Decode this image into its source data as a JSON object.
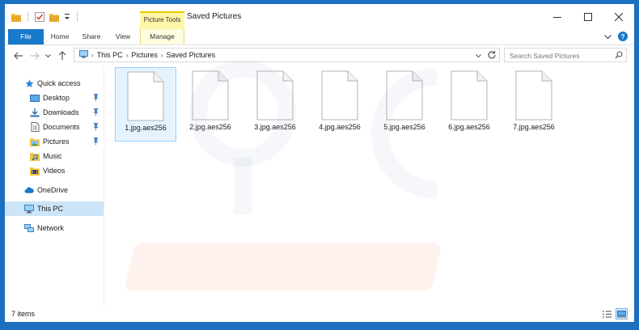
{
  "window": {
    "title": "Saved Pictures",
    "context_tab_label": "Picture Tools"
  },
  "ribbon": {
    "tabs": [
      {
        "label": "File"
      },
      {
        "label": "Home"
      },
      {
        "label": "Share"
      },
      {
        "label": "View"
      },
      {
        "label": "Manage"
      }
    ]
  },
  "address": {
    "crumbs": [
      "This PC",
      "Pictures",
      "Saved Pictures"
    ]
  },
  "search": {
    "placeholder": "Search Saved Pictures"
  },
  "nav": {
    "items": [
      {
        "label": "Quick access",
        "icon": "star-icon"
      },
      {
        "label": "Desktop",
        "icon": "desktop-folder-icon"
      },
      {
        "label": "Downloads",
        "icon": "downloads-folder-icon"
      },
      {
        "label": "Documents",
        "icon": "documents-folder-icon"
      },
      {
        "label": "Pictures",
        "icon": "pictures-folder-icon"
      },
      {
        "label": "Music",
        "icon": "music-folder-icon"
      },
      {
        "label": "Videos",
        "icon": "videos-folder-icon"
      },
      {
        "label": "OneDrive",
        "icon": "cloud-icon"
      },
      {
        "label": "This PC",
        "icon": "computer-icon"
      },
      {
        "label": "Network",
        "icon": "network-icon"
      }
    ]
  },
  "files": [
    {
      "name": "1.jpg.aes256"
    },
    {
      "name": "2.jpg.aes256"
    },
    {
      "name": "3.jpg.aes256"
    },
    {
      "name": "4.jpg.aes256"
    },
    {
      "name": "5.jpg.aes256"
    },
    {
      "name": "6.jpg.aes256"
    },
    {
      "name": "7.jpg.aes256"
    }
  ],
  "status": {
    "item_count": "7 items"
  },
  "colors": {
    "accent": "#1979ca",
    "context_tab": "#fff6a8",
    "selection": "#cce4f7",
    "watermark": "#e8532a"
  }
}
